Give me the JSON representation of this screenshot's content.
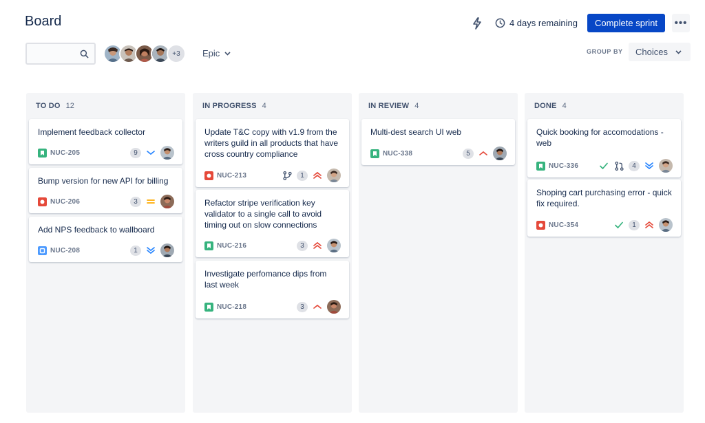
{
  "page_title": "Board",
  "header": {
    "sprint_remaining": "4 days remaining",
    "complete_sprint_label": "Complete sprint",
    "more_label": "•••"
  },
  "filters": {
    "avatars_more": "+3",
    "epic_label": "Epic",
    "group_by_label": "GROUP BY",
    "group_by_value": "Choices"
  },
  "columns": [
    {
      "name": "TO DO",
      "count": "12",
      "cards": [
        {
          "title": "Implement feedback collector",
          "key": "NUC-205",
          "type": "story",
          "badge": "9",
          "priority": "low"
        },
        {
          "title": "Bump version for new API for billing",
          "key": "NUC-206",
          "type": "bug",
          "badge": "3",
          "priority": "medium"
        },
        {
          "title": "Add NPS feedback to wallboard",
          "key": "NUC-208",
          "type": "task",
          "badge": "1",
          "priority": "lowest"
        }
      ]
    },
    {
      "name": "IN PROGRESS",
      "count": "4",
      "cards": [
        {
          "title": "Update T&C copy with v1.9 from the writers guild in all products that have cross country compliance",
          "key": "NUC-213",
          "type": "bug",
          "badge": "1",
          "priority": "highest",
          "branch": true
        },
        {
          "title": "Refactor stripe verification key validator to a single call to avoid timing out on slow connections",
          "key": "NUC-216",
          "type": "story",
          "badge": "3",
          "priority": "highest"
        },
        {
          "title": "Investigate perfomance dips from last week",
          "key": "NUC-218",
          "type": "story",
          "badge": "3",
          "priority": "high"
        }
      ]
    },
    {
      "name": "IN REVIEW",
      "count": "4",
      "cards": [
        {
          "title": "Multi-dest search UI web",
          "key": "NUC-338",
          "type": "story",
          "badge": "5",
          "priority": "high"
        }
      ]
    },
    {
      "name": "DONE",
      "count": "4",
      "cards": [
        {
          "title": "Quick booking for accomodations - web",
          "key": "NUC-336",
          "type": "story",
          "badge": "4",
          "priority": "lowest",
          "check": true,
          "pullrequest": true
        },
        {
          "title": "Shoping cart purchasing error - quick fix required.",
          "key": "NUC-354",
          "type": "bug",
          "badge": "1",
          "priority": "highest",
          "check": true
        }
      ]
    }
  ],
  "colors": {
    "primary": "#0747c6",
    "story": "#36b37e",
    "bug": "#e5493a",
    "task": "#4c9aff",
    "priority_high": "#e5493a",
    "priority_medium": "#ffab00",
    "priority_low": "#2684ff",
    "done_check": "#36b37e"
  }
}
